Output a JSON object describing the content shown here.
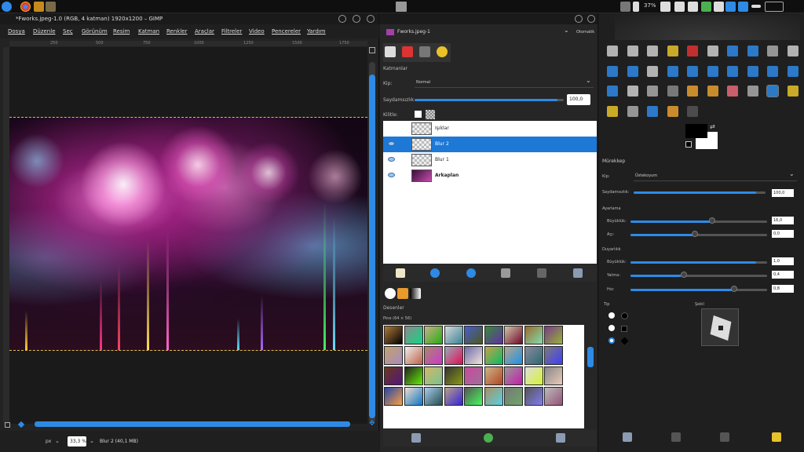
{
  "topbar": {
    "battery": "37%"
  },
  "main_window": {
    "title": "*Fworks.jpeg-1.0 (RGB, 4 katman) 1920x1200 – GIMP",
    "menu": [
      "Dosya",
      "Düzenle",
      "Seç",
      "Görünüm",
      "Resim",
      "Katman",
      "Renkler",
      "Araçlar",
      "Filtreler",
      "Video",
      "Pencereler",
      "Yardım"
    ],
    "ruler_ticks": [
      "250",
      "500",
      "750",
      "1000",
      "1250",
      "1500",
      "1750"
    ],
    "status": {
      "unit": "px",
      "zoom": "33,3 %",
      "layer_info": "Blur 2 (40,1 MB)"
    }
  },
  "layers_window": {
    "image_selector": "Fworks.jpeg-1",
    "auto_label": "Otomatik",
    "panel_title": "Katmanlar",
    "mode_label": "Kip:",
    "mode_value": "Normal",
    "opacity_label": "Saydamsızlık",
    "opacity_value": "100,0",
    "opacity_fraction": 1.0,
    "lock_label": "Kilitle:",
    "layers": [
      {
        "name": "Işıklar",
        "visible": false,
        "selected": false
      },
      {
        "name": "Blur 2",
        "visible": true,
        "selected": true
      },
      {
        "name": "Blur 1",
        "visible": true,
        "selected": false
      },
      {
        "name": "Arkaplan",
        "visible": true,
        "selected": false
      }
    ],
    "patterns_title": "Desenler",
    "patterns_subtitle": "Pine (64 × 56)"
  },
  "tool_options": {
    "title": "Mürekkep",
    "mode_label": "Kip:",
    "mode_value": "Üstekoyum",
    "opacity_label": "Saydamsızlık:",
    "opacity_value": "100,0",
    "adjustment_label": "Ayarlama",
    "size_label": "Büyüklük:",
    "size_value": "16,0",
    "angle_label": "Açı:",
    "angle_value": "0,0",
    "sensitivity_label": "Duyarlılık",
    "sens_size_label": "Büyüklük:",
    "sens_size_value": "1,0",
    "tilt_label": "Yatma:",
    "tilt_value": "0,4",
    "speed_label": "Hız:",
    "speed_value": "0,8",
    "type_label": "Tip",
    "shape_label": "Şekil"
  },
  "colors": {
    "accent": "#2e8ae6",
    "selected_layer": "#1d78d6",
    "fg_color": "#000000",
    "bg_color": "#ffffff"
  }
}
